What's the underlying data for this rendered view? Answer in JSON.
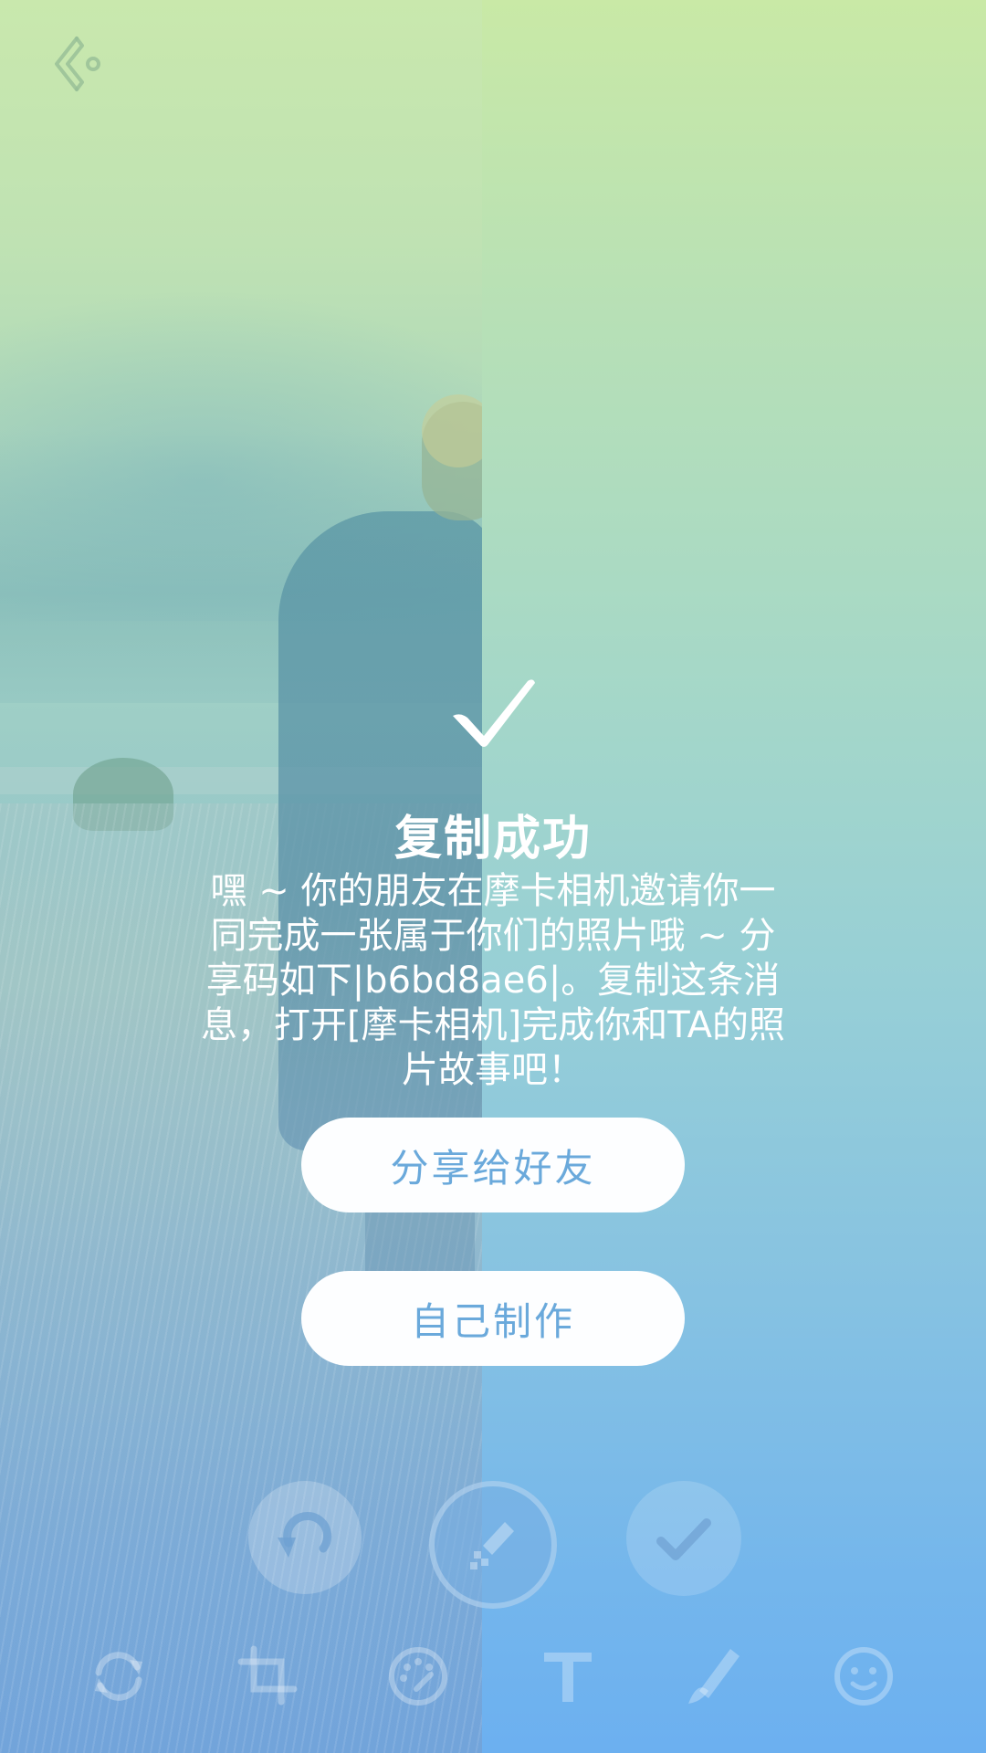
{
  "dialog": {
    "title": "复制成功",
    "message": "嘿 ~ 你的朋友在摩卡相机邀请你一同完成一张属于你们的照片哦 ~ 分享码如下|b6bd8ae6|。复制这条消息，打开[摩卡相机]完成你和TA的照片故事吧！",
    "share_button_label": "分享给好友",
    "self_button_label": "自己制作"
  },
  "colors": {
    "button_text": "#6aa9db",
    "button_bg": "#fdfeff",
    "gradient_top": "#c9e9a6",
    "gradient_bottom": "#6cb0f0"
  },
  "icons": {
    "back": "back-arrow-icon",
    "success": "checkmark-icon",
    "edit_actions": [
      "undo-icon",
      "brush-icon",
      "confirm-check-icon"
    ],
    "toolbar": [
      "rotate-icon",
      "crop-icon",
      "palette-icon",
      "text-icon",
      "draw-icon",
      "sticker-face-icon"
    ]
  }
}
